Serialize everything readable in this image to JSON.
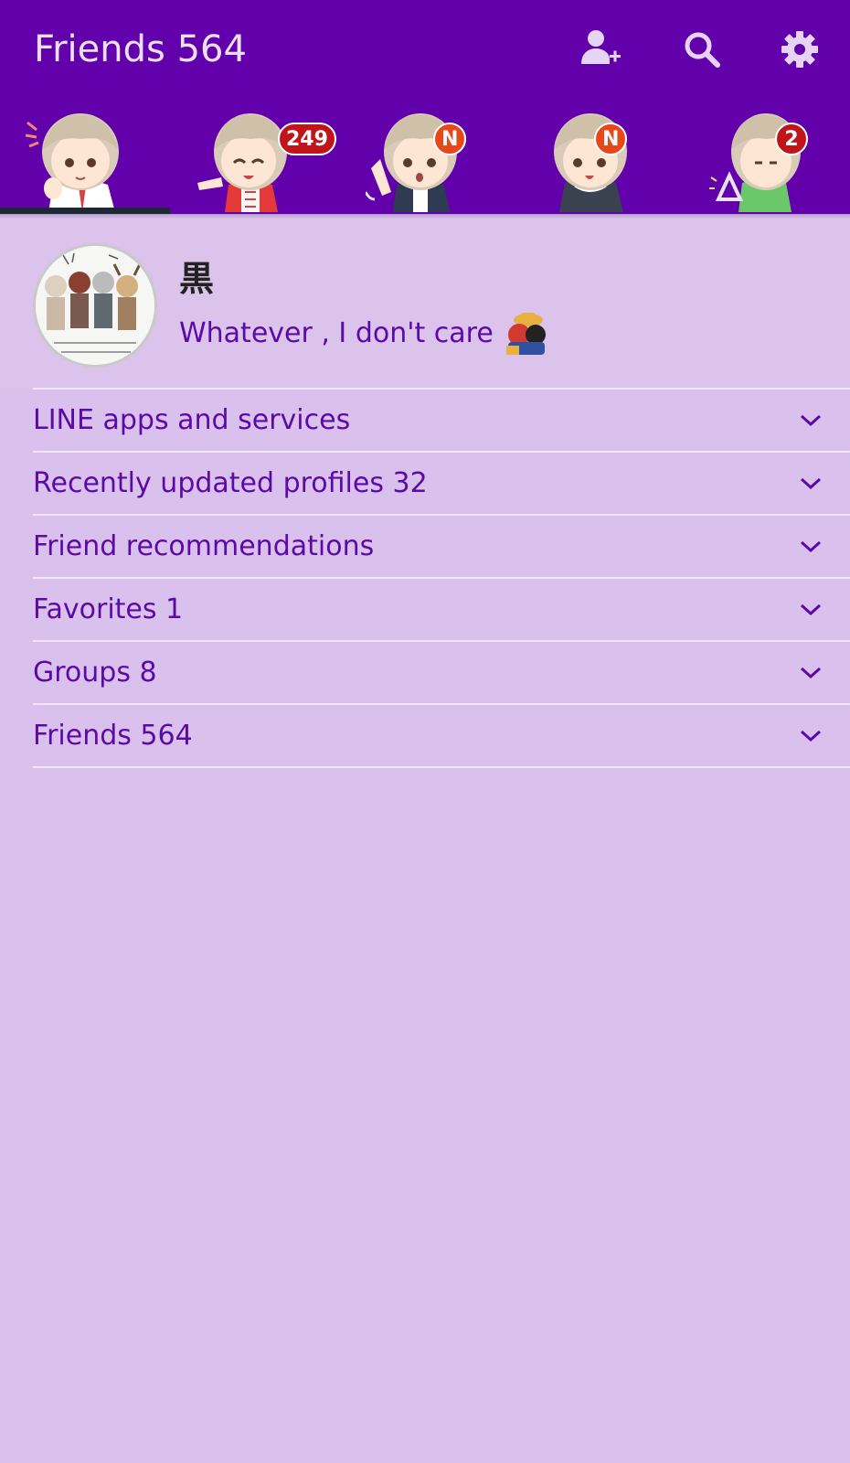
{
  "header": {
    "title": "Friends 564",
    "icons": [
      "add-friend-icon",
      "search-icon",
      "settings-icon"
    ],
    "accent": "#6200ab"
  },
  "tabs": [
    {
      "badge": ""
    },
    {
      "badge": "249"
    },
    {
      "badge": "N"
    },
    {
      "badge": "N"
    },
    {
      "badge": "2"
    }
  ],
  "profile": {
    "name": "黒",
    "status": "Whatever , I don't care"
  },
  "sections": [
    {
      "label": "LINE apps and services"
    },
    {
      "label": "Recently updated profiles 32"
    },
    {
      "label": "Friend recommendations"
    },
    {
      "label": "Favorites 1"
    },
    {
      "label": "Groups 8"
    },
    {
      "label": "Friends 564"
    }
  ]
}
